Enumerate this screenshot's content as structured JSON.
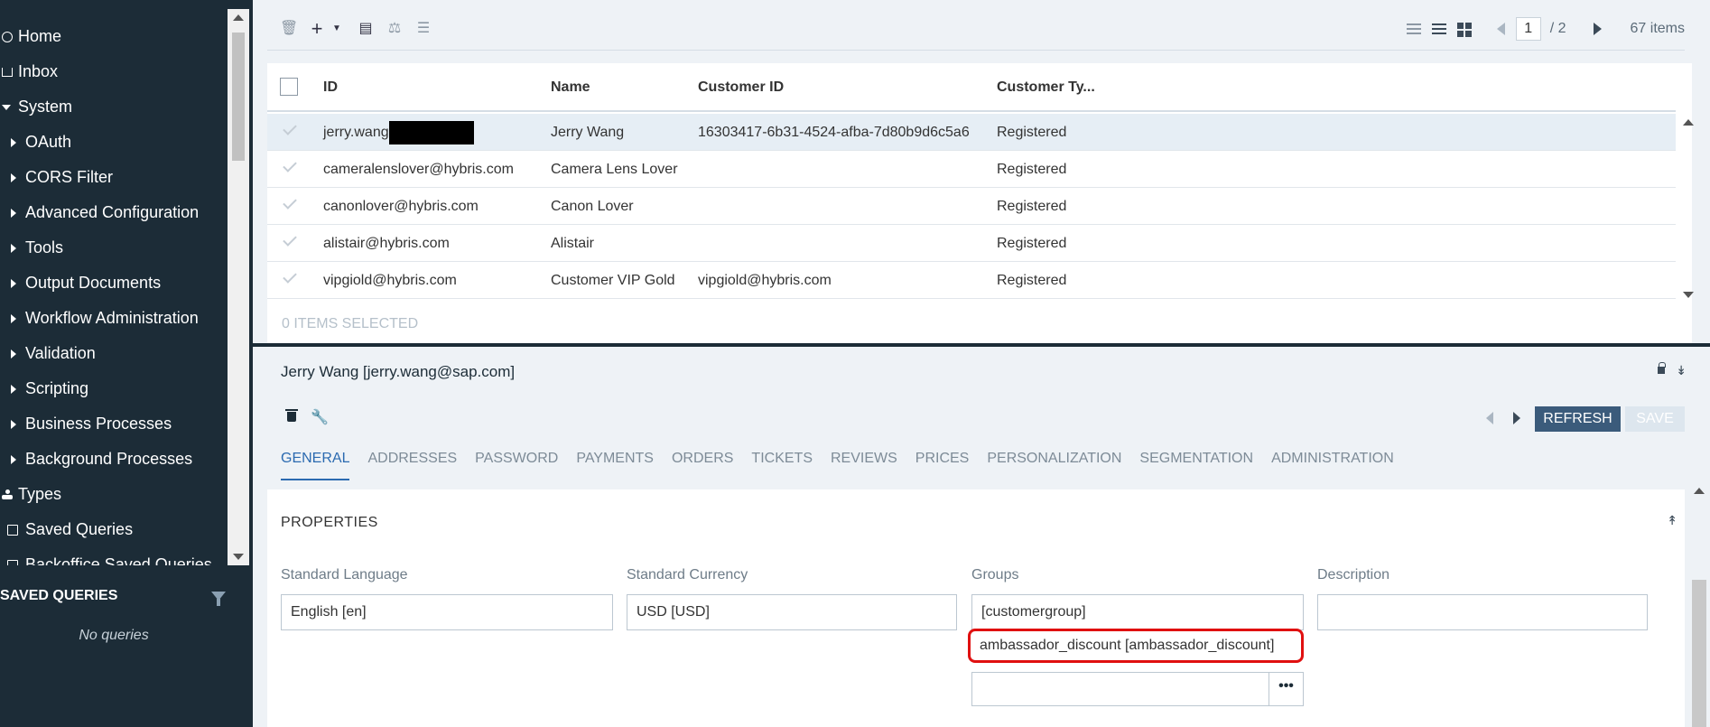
{
  "sidebar": {
    "items": [
      {
        "label": "Home"
      },
      {
        "label": "Inbox"
      },
      {
        "label": "System"
      },
      {
        "label": "OAuth"
      },
      {
        "label": "CORS Filter"
      },
      {
        "label": "Advanced Configuration"
      },
      {
        "label": "Tools"
      },
      {
        "label": "Output Documents"
      },
      {
        "label": "Workflow Administration"
      },
      {
        "label": "Validation"
      },
      {
        "label": "Scripting"
      },
      {
        "label": "Business Processes"
      },
      {
        "label": "Background Processes"
      },
      {
        "label": "Types"
      },
      {
        "label": "Saved Queries"
      },
      {
        "label": "Backoffice Saved Queries"
      }
    ],
    "saved_queries_title": "SAVED QUERIES",
    "no_queries": "No queries"
  },
  "list": {
    "page_current": "1",
    "page_total": "/ 2",
    "item_count": "67 items",
    "columns": {
      "id": "ID",
      "name": "Name",
      "customer_id": "Customer ID",
      "customer_type": "Customer Ty..."
    },
    "rows": [
      {
        "id": "jerry.wang",
        "name": "Jerry Wang",
        "customer_id": "16303417-6b31-4524-afba-7d80b9d6c5a6",
        "type": "Registered"
      },
      {
        "id": "cameralenslover@hybris.com",
        "name": "Camera Lens Lover",
        "customer_id": "",
        "type": "Registered"
      },
      {
        "id": "canonlover@hybris.com",
        "name": "Canon Lover",
        "customer_id": "",
        "type": "Registered"
      },
      {
        "id": "alistair@hybris.com",
        "name": "Alistair",
        "customer_id": "",
        "type": "Registered"
      },
      {
        "id": "vipgiold@hybris.com",
        "name": "Customer VIP Gold",
        "customer_id": "vipgiold@hybris.com",
        "type": "Registered"
      }
    ],
    "selected_text": "0 ITEMS SELECTED"
  },
  "detail": {
    "title": "Jerry Wang [jerry.wang@sap.com]",
    "refresh_label": "REFRESH",
    "save_label": "SAVE",
    "tabs": [
      "GENERAL",
      "ADDRESSES",
      "PASSWORD",
      "PAYMENTS",
      "ORDERS",
      "TICKETS",
      "REVIEWS",
      "PRICES",
      "PERSONALIZATION",
      "SEGMENTATION",
      "ADMINISTRATION"
    ],
    "properties_title": "PROPERTIES",
    "fields": {
      "language_label": "Standard Language",
      "language_value": "English [en]",
      "currency_label": "Standard Currency",
      "currency_value": "USD [USD]",
      "groups_label": "Groups",
      "groups_value": "[customergroup]",
      "groups_chip": "ambassador_discount [ambassador_discount]",
      "groups_more": "•••",
      "description_label": "Description",
      "description_value": ""
    }
  },
  "colors": {
    "sidebar_bg": "#1c2c37",
    "accent": "#2b6ab0",
    "highlight": "#e01010",
    "refresh_bg": "#3b5b7b"
  }
}
